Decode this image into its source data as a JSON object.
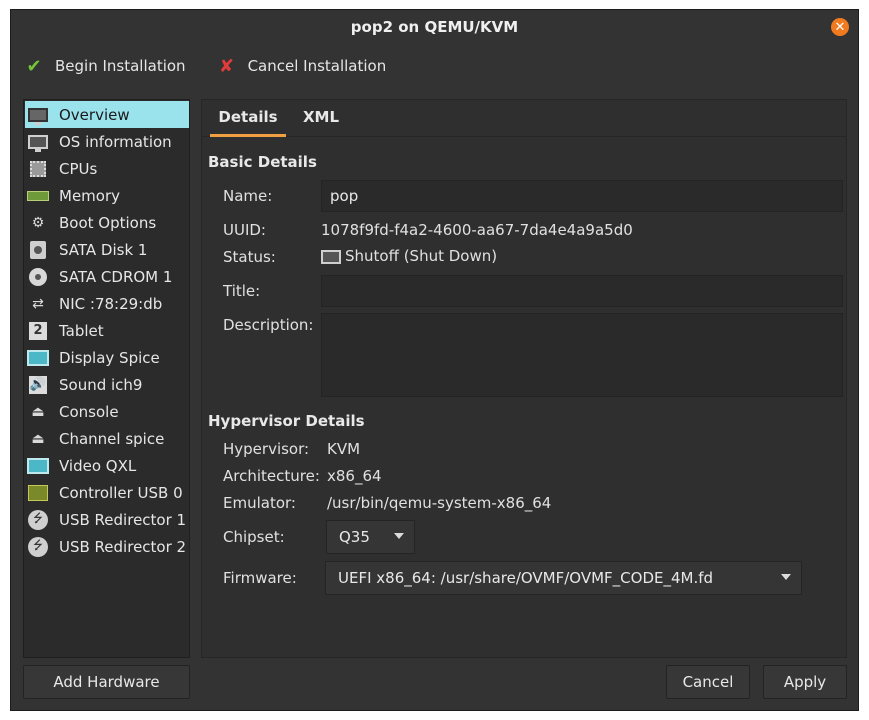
{
  "window": {
    "title": "pop2 on QEMU/KVM",
    "close_icon": "close-icon",
    "accent": "#f07a1f"
  },
  "toolbar": {
    "begin_label": "Begin Installation",
    "cancel_label": "Cancel Installation"
  },
  "sidebar": {
    "items": [
      {
        "label": "Overview",
        "icon": "monitor-icon",
        "selected": true
      },
      {
        "label": "OS information",
        "icon": "monitor-icon"
      },
      {
        "label": "CPUs",
        "icon": "cpu-icon"
      },
      {
        "label": "Memory",
        "icon": "memory-icon"
      },
      {
        "label": "Boot Options",
        "icon": "gears-icon"
      },
      {
        "label": "SATA Disk 1",
        "icon": "disk-icon"
      },
      {
        "label": "SATA CDROM 1",
        "icon": "cdrom-icon"
      },
      {
        "label": "NIC :78:29:db",
        "icon": "network-icon"
      },
      {
        "label": "Tablet",
        "icon": "tablet-icon"
      },
      {
        "label": "Display Spice",
        "icon": "display-icon"
      },
      {
        "label": "Sound ich9",
        "icon": "speaker-icon"
      },
      {
        "label": "Console",
        "icon": "serial-icon"
      },
      {
        "label": "Channel spice",
        "icon": "serial-icon"
      },
      {
        "label": "Video QXL",
        "icon": "video-icon"
      },
      {
        "label": "Controller USB 0",
        "icon": "controller-icon"
      },
      {
        "label": "USB Redirector 1",
        "icon": "usb-icon"
      },
      {
        "label": "USB Redirector 2",
        "icon": "usb-icon"
      }
    ],
    "selected_color": "#9ae3ec"
  },
  "tabs": [
    {
      "label": "Details",
      "active": true
    },
    {
      "label": "XML"
    }
  ],
  "basic": {
    "title": "Basic Details",
    "name_label": "Name:",
    "name_value": "pop",
    "uuid_label": "UUID:",
    "uuid_value": "1078f9fd-f4a2-4600-aa67-7da4e4a9a5d0",
    "status_label": "Status:",
    "status_value": "Shutoff (Shut Down)",
    "title_label": "Title:",
    "title_value": "",
    "description_label": "Description:",
    "description_value": ""
  },
  "hypervisor": {
    "title": "Hypervisor Details",
    "hypervisor_label": "Hypervisor:",
    "hypervisor_value": "KVM",
    "arch_label": "Architecture:",
    "arch_value": "x86_64",
    "emulator_label": "Emulator:",
    "emulator_value": "/usr/bin/qemu-system-x86_64",
    "chipset_label": "Chipset:",
    "chipset_value": "Q35",
    "firmware_label": "Firmware:",
    "firmware_value": "UEFI x86_64: /usr/share/OVMF/OVMF_CODE_4M.fd"
  },
  "buttons": {
    "add_hardware": "Add Hardware",
    "cancel": "Cancel",
    "apply": "Apply"
  }
}
